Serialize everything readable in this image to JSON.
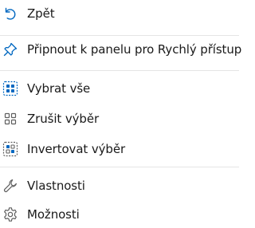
{
  "menu": {
    "items": [
      {
        "label": "Zpět",
        "icon": "undo-icon"
      },
      {
        "label": "Připnout k panelu pro Rychlý přístup",
        "icon": "pin-icon"
      },
      {
        "label": "Vybrat vše",
        "icon": "select-all-icon"
      },
      {
        "label": "Zrušit výběr",
        "icon": "select-none-icon"
      },
      {
        "label": "Invertovat výběr",
        "icon": "invert-selection-icon"
      },
      {
        "label": "Vlastnosti",
        "icon": "wrench-icon"
      },
      {
        "label": "Možnosti",
        "icon": "gear-icon"
      }
    ]
  },
  "colors": {
    "accent": "#0067c0",
    "icon_gray": "#5f5f5f",
    "separator": "#e5e5e5"
  }
}
